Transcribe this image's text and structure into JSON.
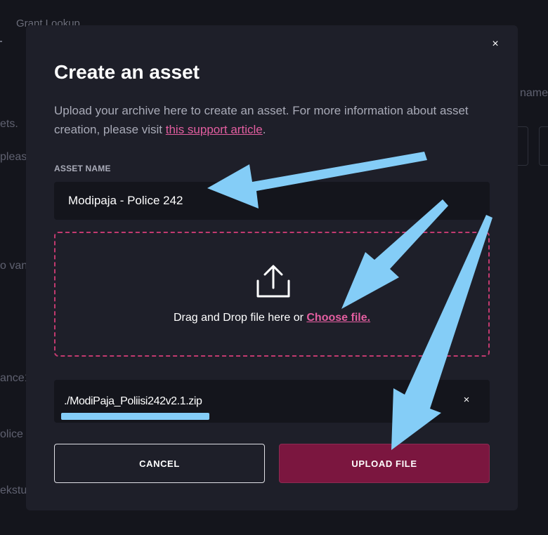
{
  "background": {
    "title": "Grant Lookup",
    "right_fragment": "name",
    "left_fragments": [
      "ets.",
      "pleas",
      "o van",
      "ance1",
      "olice",
      "ekstu"
    ]
  },
  "modal": {
    "close_glyph": "×",
    "title": "Create an asset",
    "description_prefix": "Upload your archive here to create an asset. For more information about asset creation, please visit ",
    "description_link": "this support article",
    "description_suffix": ".",
    "asset_name_label": "ASSET NAME",
    "asset_name_value": "Modipaja - Police 242",
    "dropzone": {
      "icon": "upload-icon",
      "text": "Drag and Drop file here or ",
      "link": "Choose file."
    },
    "file": {
      "name": "./ModiPaja_Poliisi242v2.1.zip",
      "remove_glyph": "×"
    },
    "cancel_label": "CANCEL",
    "upload_label": "UPLOAD FILE"
  },
  "colors": {
    "page_bg": "#14151c",
    "modal_bg": "#1e1f29",
    "accent_pink": "#e35ea0",
    "upload_button": "#7b163f",
    "annotation_blue": "#84cdf7"
  }
}
